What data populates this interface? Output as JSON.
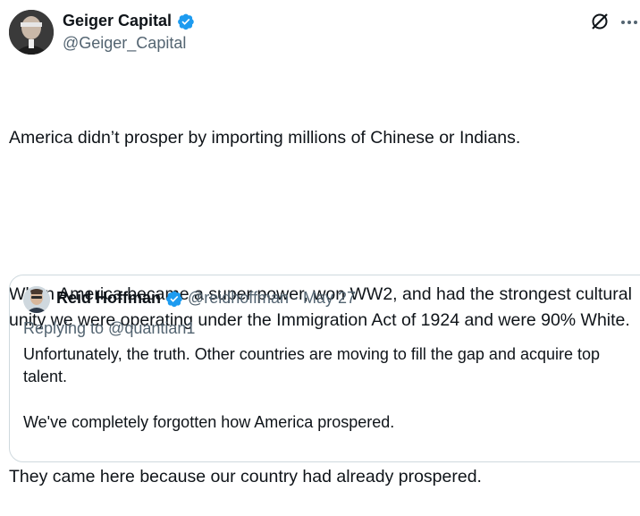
{
  "author": {
    "name": "Geiger Capital",
    "handle": "@Geiger_Capital",
    "verified_icon": "verified-badge-icon"
  },
  "actions": {
    "grok_icon": "grok-icon",
    "more_icon": "more-icon"
  },
  "tweet": {
    "paragraphs": [
      "America didn’t prosper by importing millions of Chinese or Indians.",
      "When America became a super power, won WW2, and had the strongest cultural unity we were operating under the Immigration Act of 1924 and were 90% White.",
      "They came here because our country had already prospered."
    ]
  },
  "quote": {
    "name": "Reid Hoffman",
    "handle": "@reidhoffman",
    "separator": "·",
    "date": "May 27",
    "replying_to": "Replying to @quantian1",
    "paragraphs": [
      "Unfortunately, the truth. Other countries are moving to fill the gap and acquire top talent.",
      "We've completely forgotten how America prospered."
    ]
  },
  "colors": {
    "text": "#0f1419",
    "secondary": "#536471",
    "verified": "#1d9bf0",
    "border": "#cfd9de"
  }
}
